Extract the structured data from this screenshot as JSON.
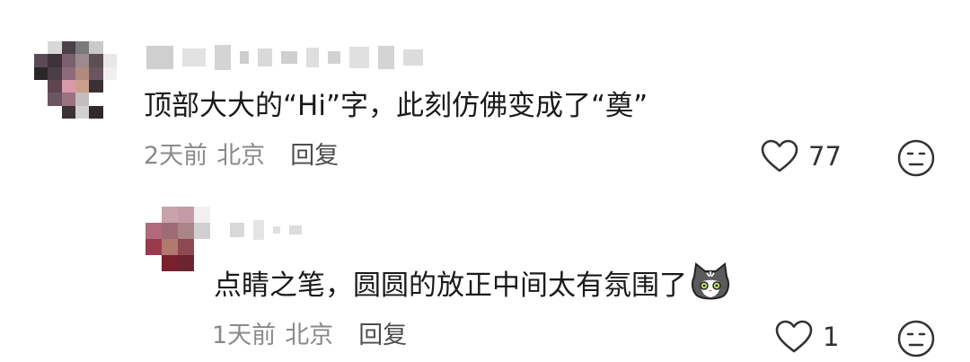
{
  "comments": [
    {
      "text": "顶部大大的“Hi”字，此刻仿佛变成了“奠”",
      "time": "2天前",
      "location": "北京",
      "reply_label": "回复",
      "likes": "77",
      "icons": [
        "heart-outline-icon",
        "neutral-face-icon"
      ]
    },
    {
      "text": "点睛之笔，圆圆的放正中间太有氛围了",
      "emoji": "cat-face-emoji",
      "time": "1天前",
      "location": "北京",
      "reply_label": "回复",
      "likes": "1",
      "icons": [
        "heart-outline-icon",
        "neutral-face-icon"
      ]
    }
  ],
  "colors": {
    "meta_gray": "#8a8a8a",
    "reply": "#4d4d4d",
    "text": "#1a1a1a"
  }
}
